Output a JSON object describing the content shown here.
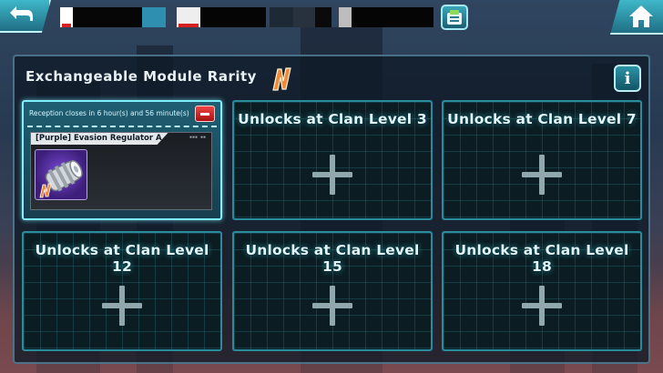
{
  "panel": {
    "title": "Exchangeable Module Rarity",
    "info_label": "i"
  },
  "active_slot": {
    "reception_text": "Reception closes in 6 hour(s) and 56 minute(s)",
    "module_name": "[Purple] Evasion Regulator A",
    "rarity": "Purple"
  },
  "locked_slots": [
    {
      "label": "Unlocks at Clan Level 3"
    },
    {
      "label": "Unlocks at Clan Level 7"
    },
    {
      "label": "Unlocks at Clan Level 12"
    },
    {
      "label": "Unlocks at Clan Level 15"
    },
    {
      "label": "Unlocks at Clan Level 18"
    }
  ],
  "icons": {
    "back": "back-arrow-icon",
    "menu": "menu-icon",
    "home": "home-icon",
    "info": "info-icon",
    "rarity": "rarity-n-icon",
    "remove": "remove-icon",
    "add": "plus-icon"
  },
  "colors": {
    "accent": "#7ef0ff",
    "slot_border": "#2a8b9c",
    "remove": "#e02828",
    "rarity_purple": "#7a4bd6"
  }
}
